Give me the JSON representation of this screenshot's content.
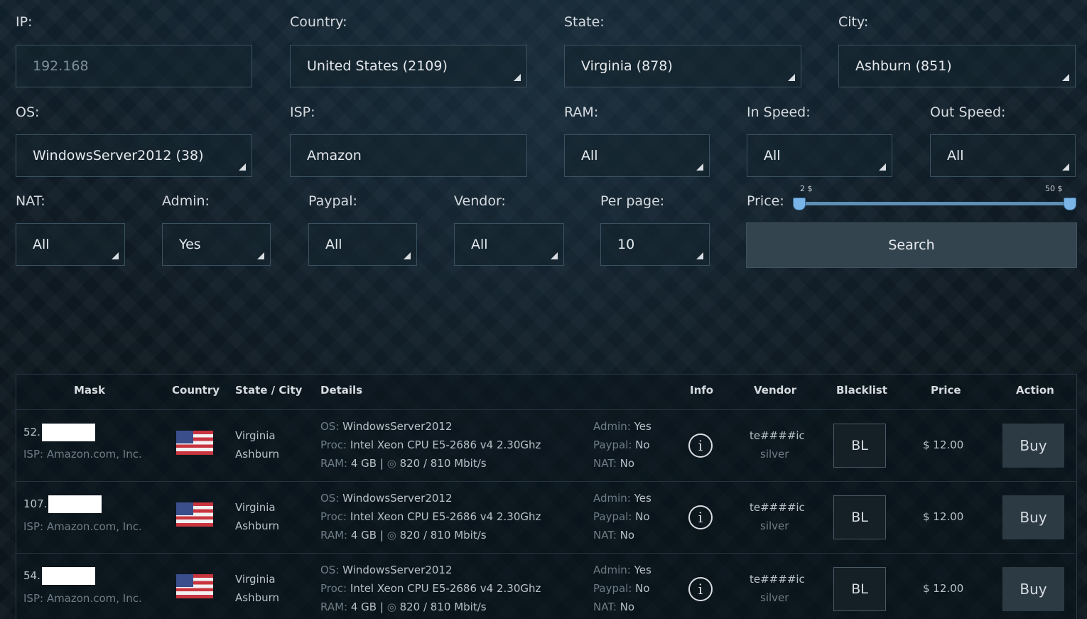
{
  "filters": {
    "ip": {
      "label": "IP:",
      "value": "192.168"
    },
    "country": {
      "label": "Country:",
      "value": "United States (2109)"
    },
    "state": {
      "label": "State:",
      "value": "Virginia (878)"
    },
    "city": {
      "label": "City:",
      "value": "Ashburn (851)"
    },
    "os": {
      "label": "OS:",
      "value": "WindowsServer2012 (38)"
    },
    "isp": {
      "label": "ISP:",
      "value": "Amazon"
    },
    "ram": {
      "label": "RAM:",
      "value": "All"
    },
    "in_speed": {
      "label": "In Speed:",
      "value": "All"
    },
    "out_speed": {
      "label": "Out Speed:",
      "value": "All"
    },
    "nat": {
      "label": "NAT:",
      "value": "All"
    },
    "admin": {
      "label": "Admin:",
      "value": "Yes"
    },
    "paypal": {
      "label": "Paypal:",
      "value": "All"
    },
    "vendor": {
      "label": "Vendor:",
      "value": "All"
    },
    "per_page": {
      "label": "Per page:",
      "value": "10"
    },
    "price": {
      "label": "Price:",
      "min_label": "2 $",
      "max_label": "50 $",
      "min": 2,
      "max": 50
    },
    "search_label": "Search"
  },
  "table": {
    "headers": [
      "Mask",
      "Country",
      "State / City",
      "Details",
      "Info",
      "Vendor",
      "Blacklist",
      "Price",
      "Action"
    ],
    "rows": [
      {
        "mask": "52.",
        "isp": "ISP: Amazon.com, Inc.",
        "state": "Virginia",
        "city": "Ashburn",
        "os_key": "OS:",
        "os": "WindowsServer2012",
        "proc_key": "Proc:",
        "proc": "Intel Xeon CPU E5-2686 v4 2.30Ghz",
        "ram_key": "RAM:",
        "ram": "4 GB |",
        "speed": "820 / 810 Mbit/s",
        "admin_key": "Admin:",
        "admin": "Yes",
        "paypal_key": "Paypal:",
        "paypal": "No",
        "nat_key": "NAT:",
        "nat": "No",
        "info": "i",
        "vendor": "te####ic",
        "vendor_level": "silver",
        "blacklist": "BL",
        "price": "$ 12.00",
        "action": "Buy"
      },
      {
        "mask": "107.",
        "isp": "ISP: Amazon.com, Inc.",
        "state": "Virginia",
        "city": "Ashburn",
        "os_key": "OS:",
        "os": "WindowsServer2012",
        "proc_key": "Proc:",
        "proc": "Intel Xeon CPU E5-2686 v4 2.30Ghz",
        "ram_key": "RAM:",
        "ram": "4 GB |",
        "speed": "820 / 810 Mbit/s",
        "admin_key": "Admin:",
        "admin": "Yes",
        "paypal_key": "Paypal:",
        "paypal": "No",
        "nat_key": "NAT:",
        "nat": "No",
        "info": "i",
        "vendor": "te####ic",
        "vendor_level": "silver",
        "blacklist": "BL",
        "price": "$ 12.00",
        "action": "Buy"
      },
      {
        "mask": "54.",
        "isp": "ISP: Amazon.com, Inc.",
        "state": "Virginia",
        "city": "Ashburn",
        "os_key": "OS:",
        "os": "WindowsServer2012",
        "proc_key": "Proc:",
        "proc": "Intel Xeon CPU E5-2686 v4 2.30Ghz",
        "ram_key": "RAM:",
        "ram": "4 GB |",
        "speed": "820 / 810 Mbit/s",
        "admin_key": "Admin:",
        "admin": "Yes",
        "paypal_key": "Paypal:",
        "paypal": "No",
        "nat_key": "NAT:",
        "nat": "No",
        "info": "i",
        "vendor": "te####ic",
        "vendor_level": "silver",
        "blacklist": "BL",
        "price": "$ 12.00",
        "action": "Buy"
      }
    ]
  },
  "colors": {
    "background": "#0e1a22",
    "field_border": "#3c5160",
    "slider": "#5e8fb5",
    "button": "#33444f"
  }
}
